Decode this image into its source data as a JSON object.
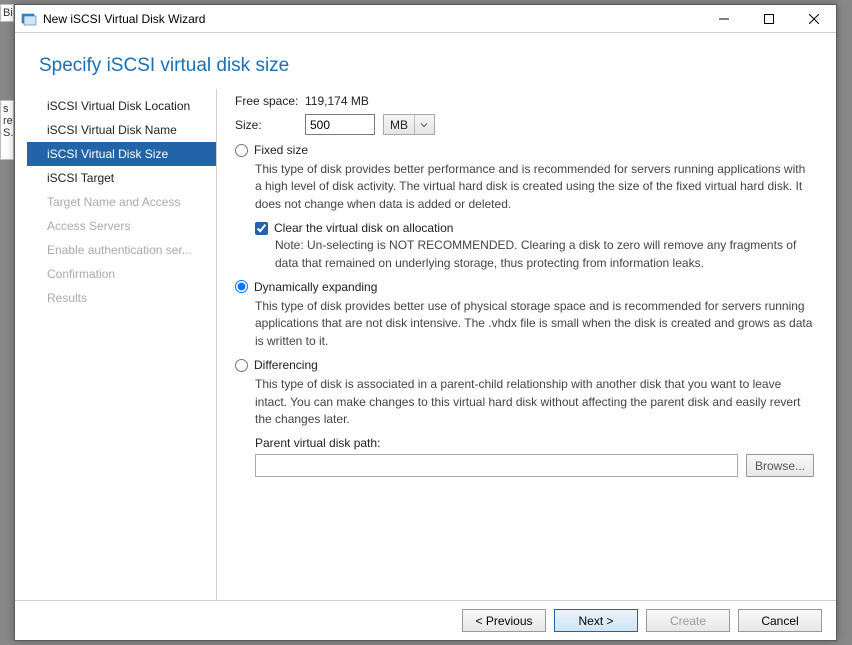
{
  "window": {
    "title": "New iSCSI Virtual Disk Wizard"
  },
  "header": {
    "title": "Specify iSCSI virtual disk size"
  },
  "sidebar": {
    "steps": [
      {
        "label": "iSCSI Virtual Disk Location",
        "state": "normal"
      },
      {
        "label": "iSCSI Virtual Disk Name",
        "state": "normal"
      },
      {
        "label": "iSCSI Virtual Disk Size",
        "state": "active"
      },
      {
        "label": "iSCSI Target",
        "state": "normal"
      },
      {
        "label": "Target Name and Access",
        "state": "disabled"
      },
      {
        "label": "Access Servers",
        "state": "disabled"
      },
      {
        "label": "Enable authentication ser...",
        "state": "disabled"
      },
      {
        "label": "Confirmation",
        "state": "disabled"
      },
      {
        "label": "Results",
        "state": "disabled"
      }
    ]
  },
  "content": {
    "free_space_label": "Free space:",
    "free_space_value": "119,174 MB",
    "size_label": "Size:",
    "size_value": "500",
    "size_unit": "MB",
    "options": {
      "fixed": {
        "label": "Fixed size",
        "desc": "This type of disk provides better performance and is recommended for servers running applications with a high level of disk activity. The virtual hard disk is created using the size of the fixed virtual hard disk. It does not change when data is added or deleted.",
        "clear_label": "Clear the virtual disk on allocation",
        "clear_note": "Note: Un-selecting is NOT RECOMMENDED. Clearing a disk to zero will remove any fragments of data that remained on underlying storage, thus protecting from information leaks.",
        "selected": false,
        "clear_checked": true
      },
      "dynamic": {
        "label": "Dynamically expanding",
        "desc": "This type of disk provides better use of physical storage space and is recommended for servers running applications that are not disk intensive. The .vhdx file is small when the disk is created and grows as data is written to it.",
        "selected": true
      },
      "diff": {
        "label": "Differencing",
        "desc": "This type of disk is associated in a parent-child relationship with another disk that you want to leave intact. You can make changes to this virtual hard disk without affecting the parent disk and easily revert the changes later.",
        "parent_label": "Parent virtual disk path:",
        "parent_value": "",
        "browse_label": "Browse...",
        "selected": false
      }
    }
  },
  "footer": {
    "previous": "< Previous",
    "next": "Next >",
    "create": "Create",
    "cancel": "Cancel"
  },
  "background": {
    "frag1": "Bi",
    "frag2": "s\nre\nS..."
  }
}
